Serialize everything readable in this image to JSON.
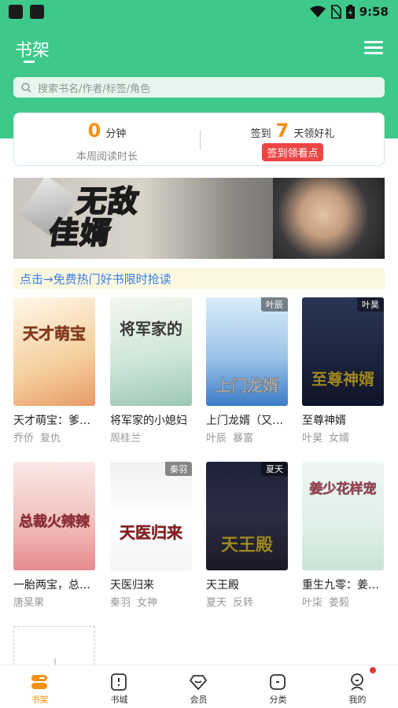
{
  "status_bar": {
    "time": "9:58"
  },
  "header": {
    "title": "书架",
    "search_placeholder": "搜索书名/作者/标签/角色"
  },
  "reading_card": {
    "minutes": "0",
    "minutes_unit": "分钟",
    "minutes_label": "本周阅读时长",
    "signin_prefix": "签到",
    "signin_days": "7",
    "signin_suffix": "天领好礼",
    "signin_button": "签到领看点"
  },
  "banner": {
    "title_line1": "无敌",
    "title_line2": "佳婿"
  },
  "promo": {
    "text": "点击→免费热门好书限时抢读"
  },
  "books": [
    {
      "name": "天才萌宝：爹…",
      "tags": [
        "乔侨",
        "复仇"
      ],
      "cover_text": "天才萌宝",
      "badge": ""
    },
    {
      "name": "将军家的小媳妇",
      "tags": [
        "周桂兰"
      ],
      "cover_text": "将军家的",
      "badge": ""
    },
    {
      "name": "上门龙婿（又…",
      "tags": [
        "叶辰",
        "暴富"
      ],
      "cover_text": "上门龙婿",
      "badge": "叶辰"
    },
    {
      "name": "至尊神婿",
      "tags": [
        "叶昊",
        "女婿"
      ],
      "cover_text": "至尊神婿",
      "badge": "叶昊"
    },
    {
      "name": "一胎两宝，总…",
      "tags": [
        "唐昊果"
      ],
      "cover_text": "总裁火辣辣",
      "badge": ""
    },
    {
      "name": "天医归来",
      "tags": [
        "秦羽",
        "女神"
      ],
      "cover_text": "天医归来",
      "badge": "秦羽"
    },
    {
      "name": "天王殿",
      "tags": [
        "夏天",
        "反转"
      ],
      "cover_text": "天王殿",
      "badge": "夏天"
    },
    {
      "name": "重生九零：姜…",
      "tags": [
        "叶柒",
        "姜毅"
      ],
      "cover_text": "姜少花样宠",
      "badge": ""
    }
  ],
  "nav": [
    {
      "label": "书架",
      "icon": "bookshelf-icon"
    },
    {
      "label": "书城",
      "icon": "bookstore-icon"
    },
    {
      "label": "会员",
      "icon": "member-icon"
    },
    {
      "label": "分类",
      "icon": "category-icon"
    },
    {
      "label": "我的",
      "icon": "profile-icon"
    }
  ],
  "colors": {
    "header": "#3ec98a",
    "accent": "#f39016",
    "red": "#ee4444"
  }
}
